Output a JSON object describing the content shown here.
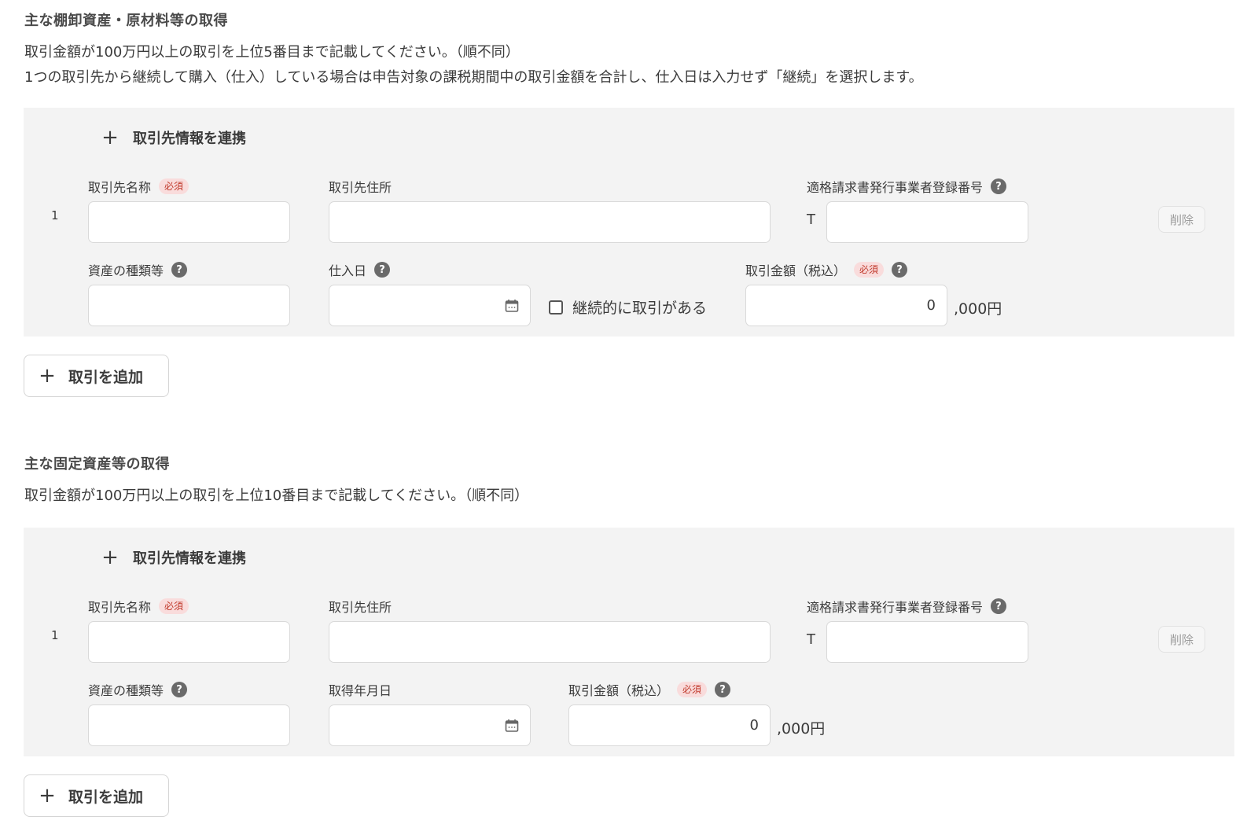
{
  "section1": {
    "title": "主な棚卸資産・原材料等の取得",
    "desc_line1": "取引金額が100万円以上の取引を上位5番目まで記載してください。（順不同）",
    "desc_line2": "1つの取引先から継続して購入（仕入）している場合は申告対象の課税期間中の取引金額を合計し、仕入日は入力せず「継続」を選択します。",
    "link_label": "取引先情報を連携",
    "row_no": "1",
    "partner_name_label": "取引先名称",
    "required": "必須",
    "address_label": "取引先住所",
    "invoice_label": "適格請求書発行事業者登録番号",
    "t_prefix": "T",
    "delete_label": "削除",
    "asset_type_label": "資産の種類等",
    "date_label": "仕入日",
    "continuous_label": "継続的に取引がある",
    "amount_label": "取引金額（税込）",
    "amount_value": "0",
    "amount_unit": ",000円",
    "add_label": "取引を追加"
  },
  "section2": {
    "title": "主な固定資産等の取得",
    "desc_line1": "取引金額が100万円以上の取引を上位10番目まで記載してください。（順不同）",
    "link_label": "取引先情報を連携",
    "row_no": "1",
    "partner_name_label": "取引先名称",
    "required": "必須",
    "address_label": "取引先住所",
    "invoice_label": "適格請求書発行事業者登録番号",
    "t_prefix": "T",
    "delete_label": "削除",
    "asset_type_label": "資産の種類等",
    "date_label": "取得年月日",
    "amount_label": "取引金額（税込）",
    "amount_value": "0",
    "amount_unit": ",000円",
    "add_label": "取引を追加"
  },
  "icons": {
    "plus": "plus-icon",
    "help": "question-circle-icon",
    "calendar": "calendar-icon"
  },
  "colors": {
    "panel_bg": "#f3f3f3",
    "required_text": "#c0392b",
    "required_bg": "#f9dcdc"
  }
}
